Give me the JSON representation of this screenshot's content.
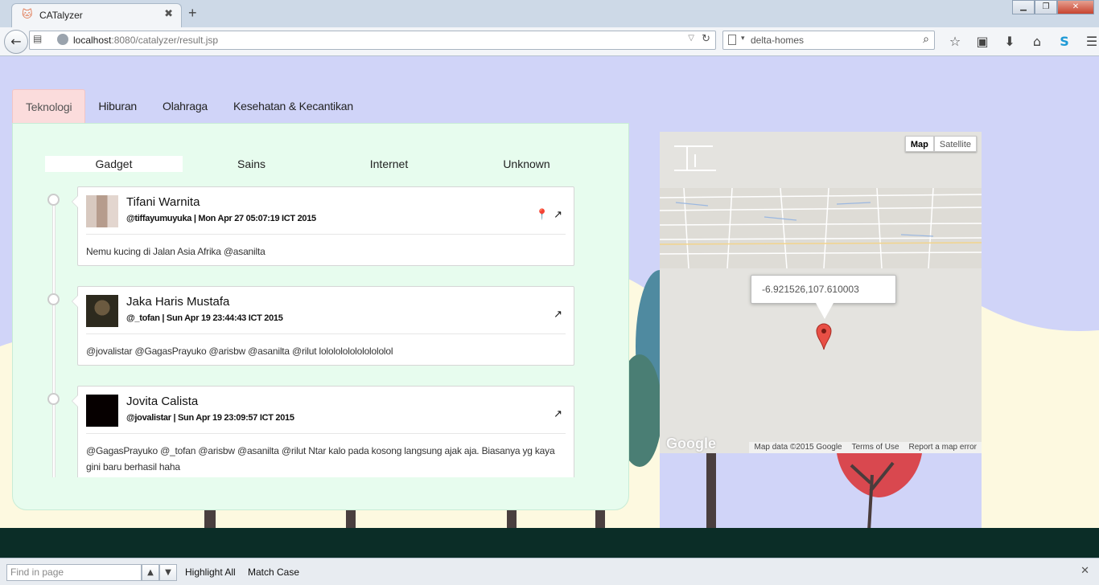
{
  "browser": {
    "tab_title": "CATalyzer",
    "tab_close": "✖",
    "new_tab": "+",
    "url_host": "localhost",
    "url_rest": ":8080/catalyzer/result.jsp",
    "search_text": "delta-homes",
    "window_buttons": [
      "▁",
      "❐",
      "✕"
    ]
  },
  "category_tabs": [
    {
      "label": "Teknologi",
      "active": true
    },
    {
      "label": "Hiburan",
      "active": false
    },
    {
      "label": "Olahraga",
      "active": false
    },
    {
      "label": "Kesehatan & Kecantikan",
      "active": false
    }
  ],
  "sub_tabs": [
    {
      "label": "Gadget",
      "active": true
    },
    {
      "label": "Sains",
      "active": false
    },
    {
      "label": "Internet",
      "active": false
    },
    {
      "label": "Unknown",
      "active": false
    }
  ],
  "tweets": [
    {
      "name": "Tifani Warnita",
      "meta": "@tiffayumuyuka | Mon Apr 27 05:07:19 ICT 2015",
      "text": "Nemu kucing di Jalan Asia Afrika @asanilta",
      "has_location": true,
      "avatar_color": "#c9b5a8"
    },
    {
      "name": "Jaka Haris Mustafa",
      "meta": "@_tofan | Sun Apr 19 23:44:43 ICT 2015",
      "text": "@jovalistar @GagasPrayuko @arisbw @asanilta @rilut lolololololololololol",
      "has_location": false,
      "avatar_color": "#3a3626"
    },
    {
      "name": "Jovita Calista",
      "meta": "@jovalistar | Sun Apr 19 23:09:57 ICT 2015",
      "text": "@GagasPrayuko @_tofan @arisbw @asanilta @rilut Ntar kalo pada kosong langsung ajak aja. Biasanya yg kaya gini baru berhasil haha",
      "has_location": false,
      "avatar_color": "#060000"
    }
  ],
  "map": {
    "type_map": "Map",
    "type_satellite": "Satellite",
    "popup": "-6.921526,107.610003",
    "logo": "Google",
    "attribution": [
      "Map data ©2015 Google",
      "Terms of Use",
      "Report a map error"
    ]
  },
  "findbar": {
    "placeholder": "Find in page",
    "highlight_all": "Highlight All",
    "match_case": "Match Case"
  },
  "colors": {
    "sky": "#d0d4f8",
    "card": "#e7fcee",
    "active_tab": "#fbdcdc",
    "ground": "#0b2d27",
    "marker": "#e84f45"
  }
}
